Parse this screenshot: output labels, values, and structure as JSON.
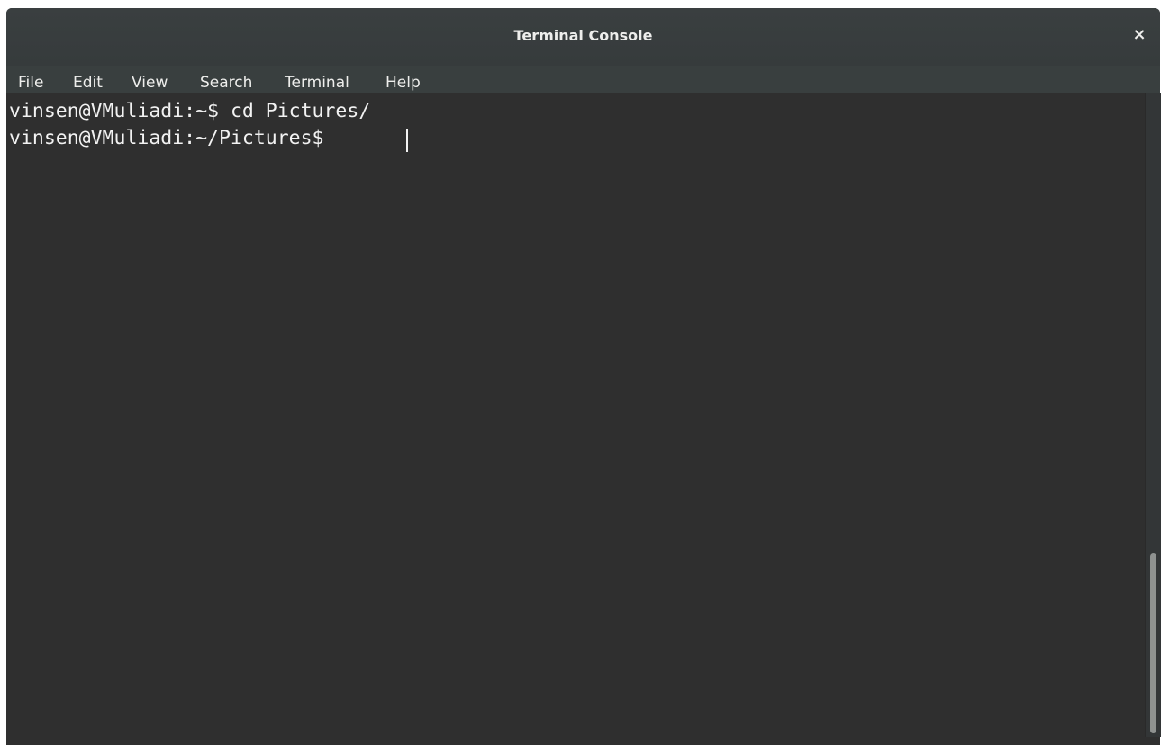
{
  "window": {
    "title": "Terminal Console",
    "close_icon": "close-icon",
    "close_glyph": "×"
  },
  "menu": {
    "items": [
      {
        "label": "File"
      },
      {
        "label": "Edit"
      },
      {
        "label": "View"
      },
      {
        "label": "Search"
      },
      {
        "label": "Terminal"
      },
      {
        "label": "Help"
      }
    ]
  },
  "terminal": {
    "lines": [
      "vinsen@VMuliadi:~$ cd Pictures/",
      "vinsen@VMuliadi:~/Pictures$ "
    ]
  },
  "colors": {
    "background": "#2f2f2f",
    "foreground": "#f2f2f2",
    "titlebar": "#383d3e"
  }
}
